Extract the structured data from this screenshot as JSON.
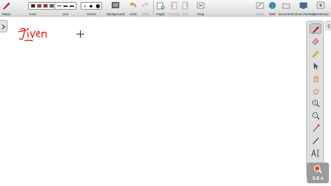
{
  "toolbar": {
    "status_label": "Status",
    "color_label": "Color",
    "line_label": "Line",
    "eraser_label": "Eraser",
    "backgrounds_label": "Backgrounds",
    "undo_label": "Undo",
    "redo_label": "Redo",
    "pages_label": "Pages",
    "previous_label": "Previous",
    "next_label": "Next",
    "snap_label": "Snap",
    "board_label": "Board",
    "web_label": "Web",
    "documents_label": "Documents",
    "show_desktop_label": "Show Desktop",
    "openboard_label": "OpenBoard",
    "colors": [
      "#222222",
      "#e02020",
      "#c81e1e",
      "#1e7ea8",
      "#f0c020"
    ]
  },
  "canvas": {
    "handwriting_text": "Given",
    "ink_color": "#e0201c"
  },
  "zoom": {
    "label": "5.6 x"
  }
}
